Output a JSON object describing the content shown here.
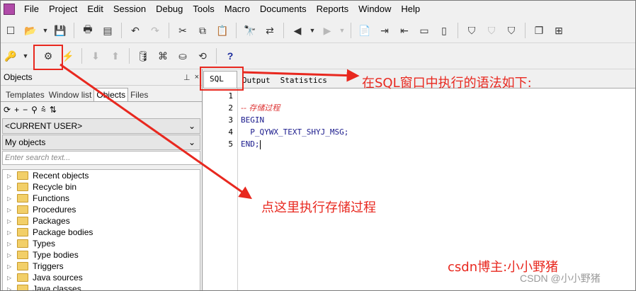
{
  "menu": [
    "File",
    "Project",
    "Edit",
    "Session",
    "Debug",
    "Tools",
    "Macro",
    "Documents",
    "Reports",
    "Window",
    "Help"
  ],
  "left_panel": {
    "title": "Objects",
    "pin": "📌",
    "close": "×",
    "tabs": [
      "Templates",
      "Window list",
      "Objects",
      "Files"
    ],
    "active_tab": "Objects",
    "user_combo": "<CURRENT USER>",
    "objects_combo": "My objects",
    "search_placeholder": "Enter search text...",
    "tree": [
      "Recent objects",
      "Recycle bin",
      "Functions",
      "Procedures",
      "Packages",
      "Package bodies",
      "Types",
      "Type bodies",
      "Triggers",
      "Java sources",
      "Java classes"
    ]
  },
  "editor": {
    "tabs": [
      "SQL",
      "Output",
      "Statistics"
    ],
    "active_tab": "SQL",
    "line_numbers": [
      "1",
      "2",
      "3",
      "4",
      "5"
    ],
    "lines": [
      "",
      "-- 存储过程",
      "BEGIN",
      "  P_QYWX_TEXT_SHYJ_MSG;",
      "END;"
    ]
  },
  "annotations": {
    "sql_window_note": "在SQL窗口中执行的语法如下:",
    "execute_note": "点这里执行存储过程",
    "author_note": "csdn博主:小小野猪",
    "color": "#e8281f"
  },
  "watermark": "CSDN @小小野猪",
  "colors": {
    "accent": "#e8281f",
    "keyword": "#1a1a8c",
    "comment": "#dd3333",
    "folder": "#f2cf68"
  }
}
